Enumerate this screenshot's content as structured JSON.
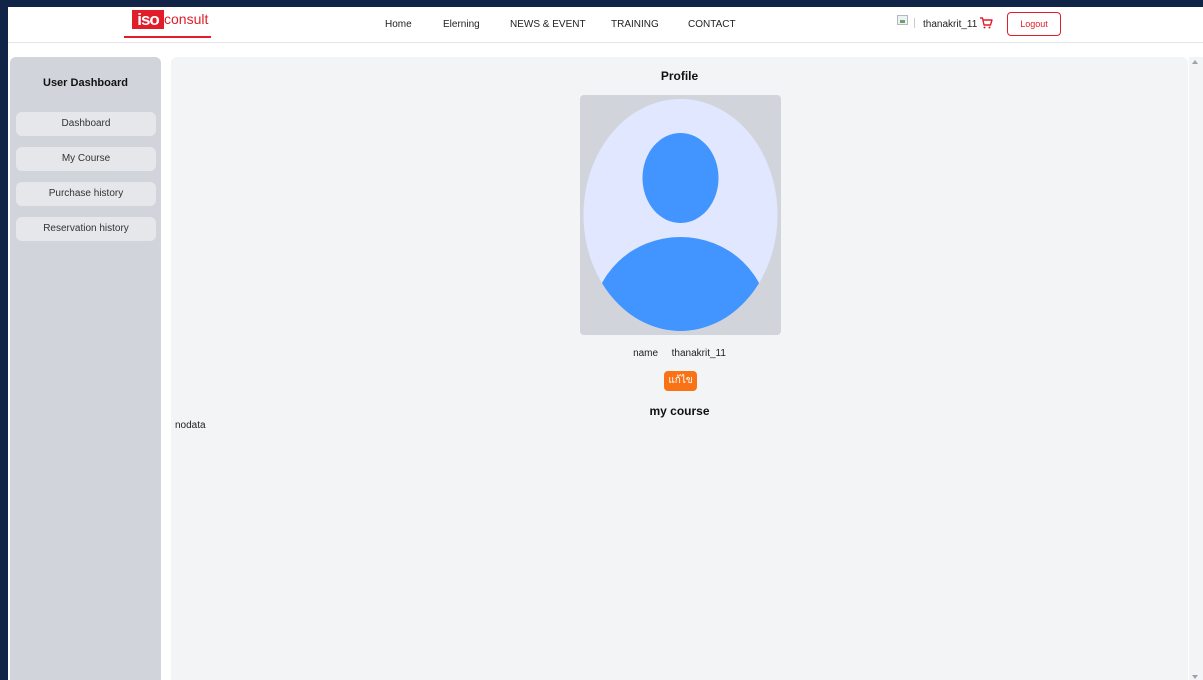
{
  "header": {
    "logo": {
      "mark": "iso",
      "rest": "consult"
    },
    "nav": [
      {
        "label": "Home"
      },
      {
        "label": "Elerning"
      },
      {
        "label": "NEWS & EVENT"
      },
      {
        "label": "TRAINING"
      },
      {
        "label": "CONTACT"
      }
    ],
    "username": "thanakrit_11",
    "logout_label": "Logout",
    "cart_icon": "cart-icon",
    "brand_color": "#e11d2a"
  },
  "sidebar": {
    "title": "User Dashboard",
    "items": [
      {
        "label": "Dashboard"
      },
      {
        "label": "My Course"
      },
      {
        "label": "Purchase history"
      },
      {
        "label": "Reservation history"
      }
    ]
  },
  "main": {
    "profile_title": "Profile",
    "name_label": "name",
    "name_value": "thanakrit_11",
    "edit_label": "แก้ไข",
    "my_course_title": "my course",
    "nodata_text": "nodata",
    "avatar_colors": {
      "bg": "#e0e7ff",
      "figure": "#4294ff"
    },
    "accent_color": "#f97316"
  }
}
